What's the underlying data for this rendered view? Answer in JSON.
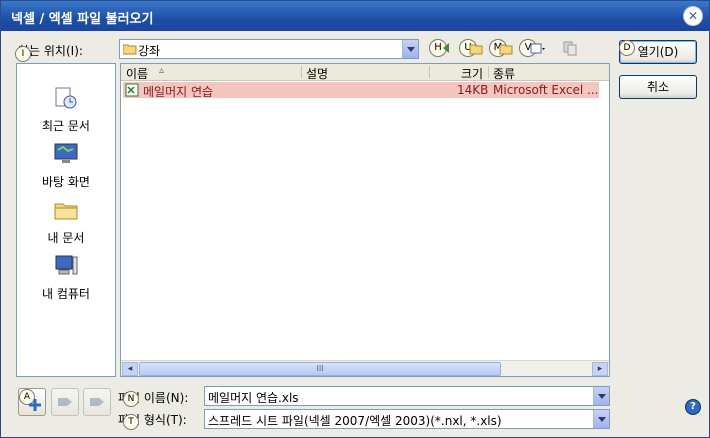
{
  "window": {
    "title": "넥셀 / 엑셀 파일 불러오기",
    "close_symbol": "✕"
  },
  "lookin": {
    "label": "찾는 위치(I):",
    "hotkey": "I",
    "value": "강좌"
  },
  "toolbar": {
    "h": "H",
    "u": "U",
    "m": "M",
    "v": "V"
  },
  "places": [
    {
      "label": "최근 문서"
    },
    {
      "label": "바탕 화면"
    },
    {
      "label": "내 문서"
    },
    {
      "label": "내 컴퓨터"
    }
  ],
  "columns": {
    "name": "이름",
    "sort_arrow": "▵",
    "desc": "설명",
    "size": "크기",
    "type": "종류"
  },
  "files": [
    {
      "name": "메일머지 연습",
      "size": "14KB",
      "type": "Microsoft Excel ..."
    }
  ],
  "scrollbar": {
    "left_arrow": "◂",
    "right_arrow": "▸",
    "grip": "III"
  },
  "filename": {
    "label": "파일 이름(N):",
    "hotkey": "N",
    "value": "메일머지 연습.xls"
  },
  "filetype": {
    "label": "파일 형식(T):",
    "hotkey": "T",
    "value": "스프레드 시트 파일(넥셀 2007/엑셀 2003)(*.nxl, *.xls)"
  },
  "buttons": {
    "open": "열기(D)",
    "open_hotkey": "D",
    "cancel": "취소",
    "add_hotkey": "A"
  },
  "help_symbol": "?"
}
